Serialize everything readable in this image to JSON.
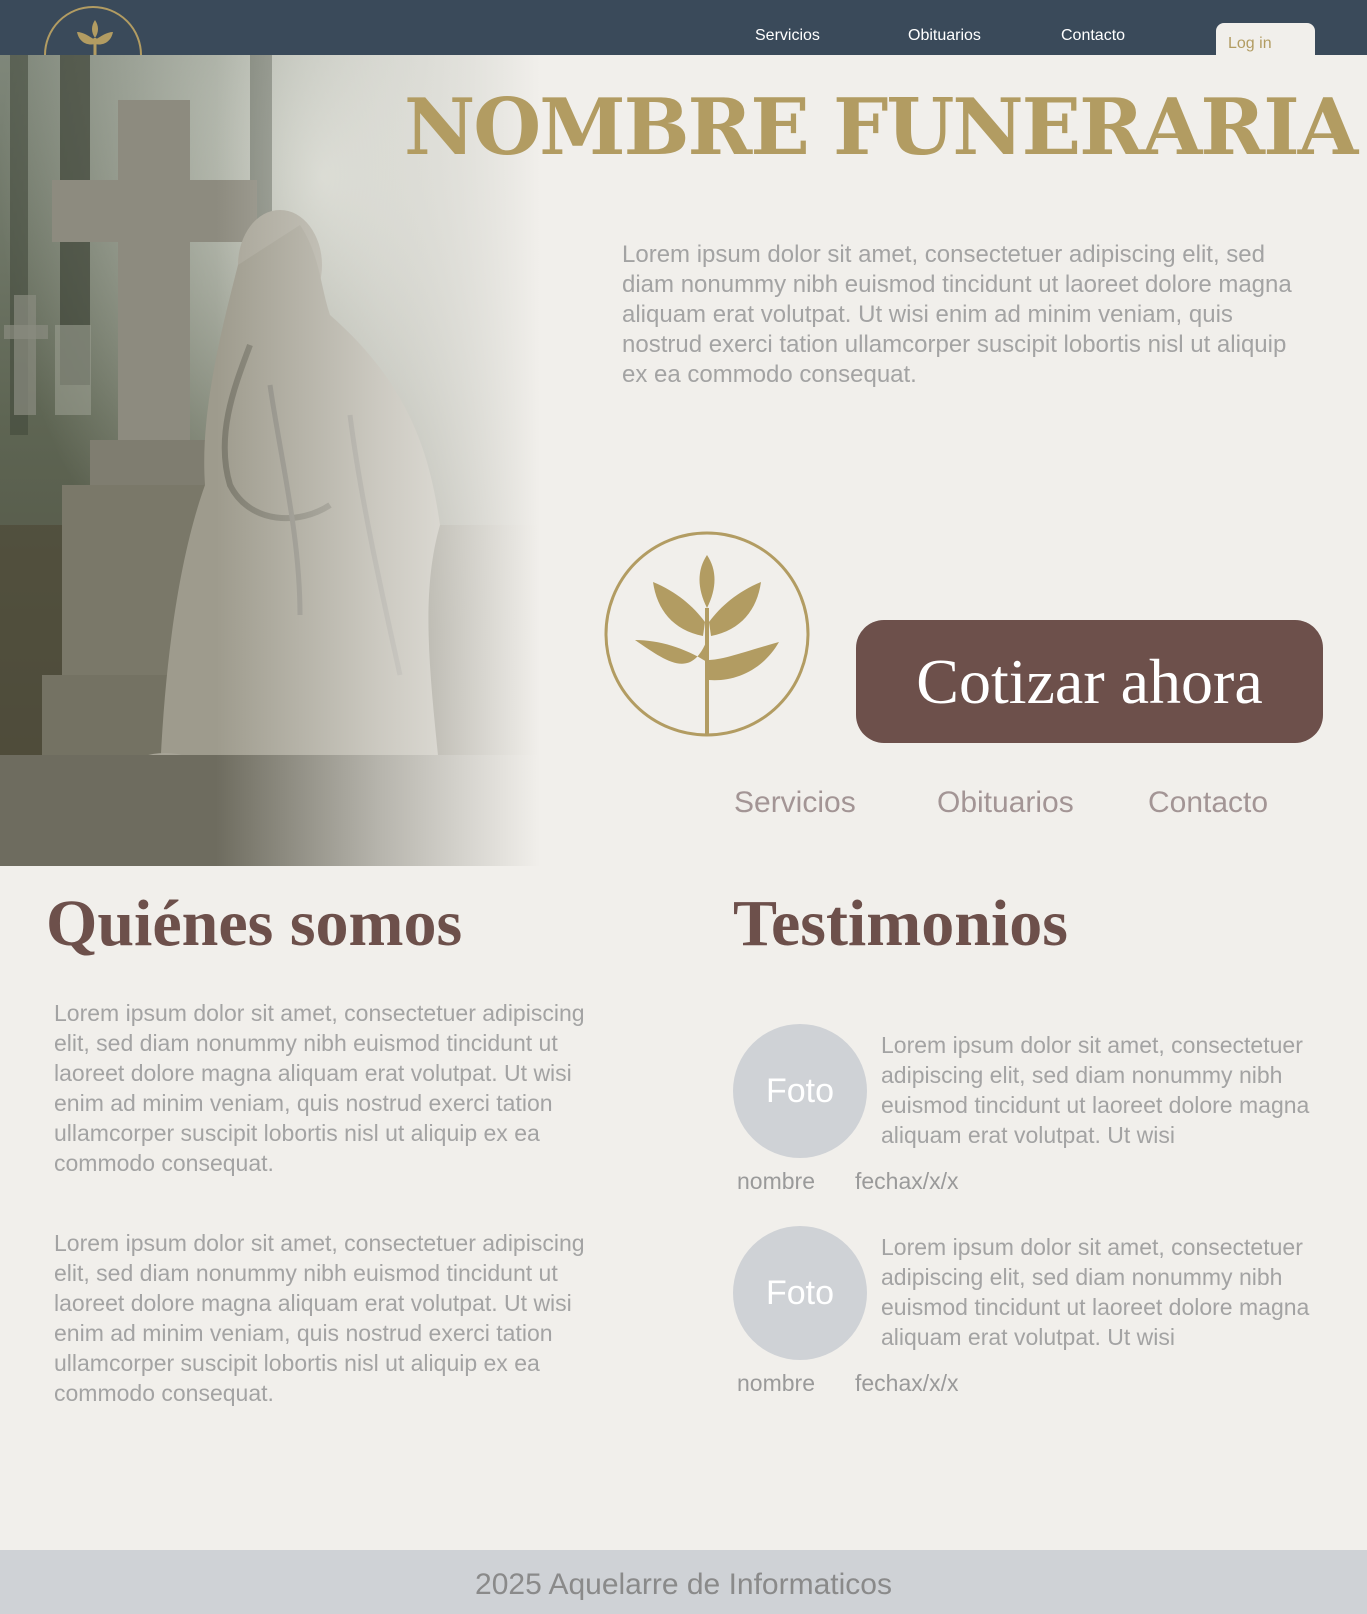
{
  "nav": {
    "items": [
      "Servicios",
      "Obituarios",
      "Contacto"
    ],
    "login_label": "Log in"
  },
  "hero": {
    "title": "NOMBRE FUNERARIA",
    "text": "Lorem ipsum dolor sit amet, consectetuer adipiscing elit, sed diam nonummy nibh euismod tincidunt ut laoreet dolore magna aliquam erat volutpat. Ut wisi enim ad minim veniam, quis nostrud exerci tation ullamcorper suscipit lobortis nisl ut aliquip ex ea commodo consequat.",
    "cta_label": "Cotizar ahora",
    "subnav": [
      "Servicios",
      "Obituarios",
      "Contacto"
    ]
  },
  "about": {
    "title": "Quiénes somos",
    "paragraphs": [
      "Lorem ipsum dolor sit amet, consectetuer adipis­cing elit, sed diam nonummy nibh euismod tinci­dunt ut laoreet dolore magna aliquam erat volut­pat. Ut wisi enim ad minim veniam, quis nostrud exerci tation ullamcorper suscipit lobortis nisl ut aliquip ex ea commodo consequat.",
      "Lorem ipsum dolor sit amet, consectetuer adipis­cing elit, sed diam nonummy nibh euismod tinci­dunt ut laoreet dolore magna aliquam erat volut­pat. Ut wisi enim ad minim veniam, quis nostrud exerci tation ullamcorper suscipit lobortis nisl ut aliquip ex ea commodo consequat."
    ]
  },
  "testimonials": {
    "title": "Testimonios",
    "items": [
      {
        "photo_label": "Foto",
        "quote": "Lorem ipsum dolor sit amet, consecte­tuer adipiscing elit, sed diam nonummy nibh euismod tincidunt ut laoreet dolore magna aliquam erat volutpat. Ut wisi",
        "name": "nombre",
        "date": "fechax/x/x"
      },
      {
        "photo_label": "Foto",
        "quote": "Lorem ipsum dolor sit amet, consecte­tuer adipiscing elit, sed diam nonummy nibh euismod tincidunt ut laoreet dolore magna aliquam erat volutpat. Ut wisi",
        "name": "nombre",
        "date": "fechax/x/x"
      }
    ]
  },
  "footer": {
    "text": "2025 Aquelarre de Informaticos"
  },
  "icons": {
    "brand_logo": "lily-flower-icon",
    "hero_image": "cemetery-statue-photo"
  },
  "colors": {
    "nav_bg": "#3a4a5a",
    "gold": "#b29c62",
    "cta_bg": "#6d504b",
    "page_bg": "#f1efeb",
    "footer_bg": "#cfd2d6"
  }
}
